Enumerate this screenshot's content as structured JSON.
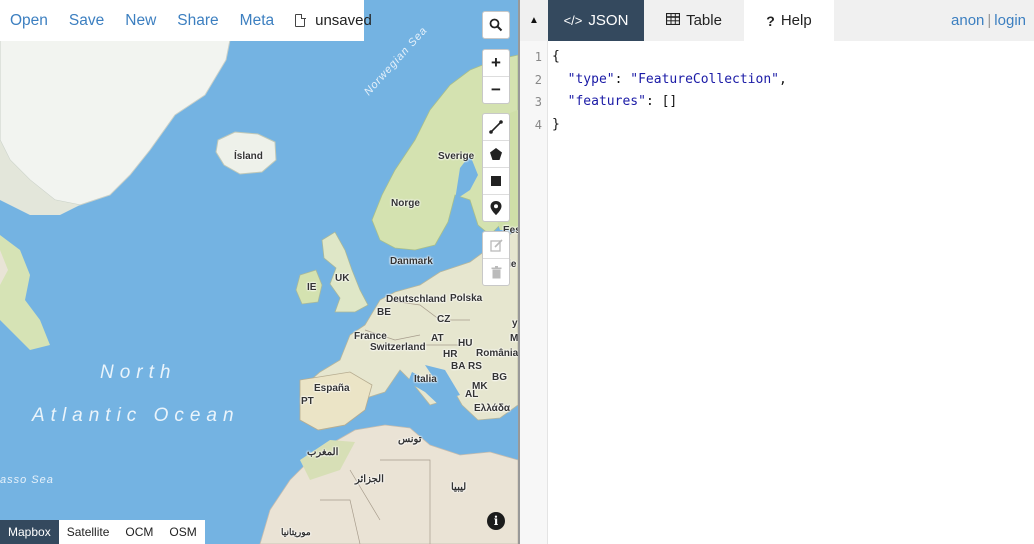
{
  "menu": {
    "open": "Open",
    "save": "Save",
    "new": "New",
    "share": "Share",
    "meta": "Meta",
    "file_state": "unsaved"
  },
  "map": {
    "labels": {
      "island": "Ísland",
      "sverige": "Sverige",
      "norge": "Norge",
      "danmark": "Danmark",
      "uk": "UK",
      "ie": "IE",
      "deutschland": "Deutschland",
      "polska": "Polska",
      "be": "BE",
      "cz": "CZ",
      "france": "France",
      "switzerland": "Switzerland",
      "at": "AT",
      "hu": "HU",
      "hr": "HR",
      "romania": "România",
      "ba": "BA",
      "rs": "RS",
      "bg": "BG",
      "italia": "Italia",
      "mk": "MK",
      "al": "AL",
      "ellada": "Ελλάδα",
      "espana": "España",
      "pt": "PT",
      "tunes": "تونس",
      "maghrib": "المغرب",
      "jazair": "الجزائر",
      "libya": "ليبيا",
      "mauritania": "موريتانيا",
      "eesti": "Eesti",
      "latvija": "Lie",
      "y_edge": "y",
      "md": "M"
    },
    "ocean_line1": "North",
    "ocean_line2": "Atlantic Ocean",
    "norwegian_sea": "Norwegian Sea",
    "sargasso_sea": "asso Sea",
    "layers": [
      "Mapbox",
      "Satellite",
      "OCM",
      "OSM"
    ],
    "active_layer": "Mapbox",
    "zoom_in": "+",
    "zoom_out": "−",
    "info": "i"
  },
  "pane": {
    "tabs": {
      "json": "JSON",
      "table": "Table",
      "help": "Help"
    },
    "user": {
      "anon": "anon",
      "sep": "|",
      "login": "login"
    },
    "editor": {
      "line_numbers": [
        "1",
        "2",
        "3",
        "4"
      ],
      "line1": "{",
      "type_key": "\"type\"",
      "type_value": "\"FeatureCollection\"",
      "features_key": "\"features\"",
      "features_value": "[]",
      "line4": "}"
    }
  },
  "colors": {
    "water": "#74b3e2",
    "land": "#e9e4d6",
    "forest": "#cfdfa8",
    "ice": "#f4f6f2",
    "accent": "#34495e",
    "link": "#3c7fc0"
  }
}
